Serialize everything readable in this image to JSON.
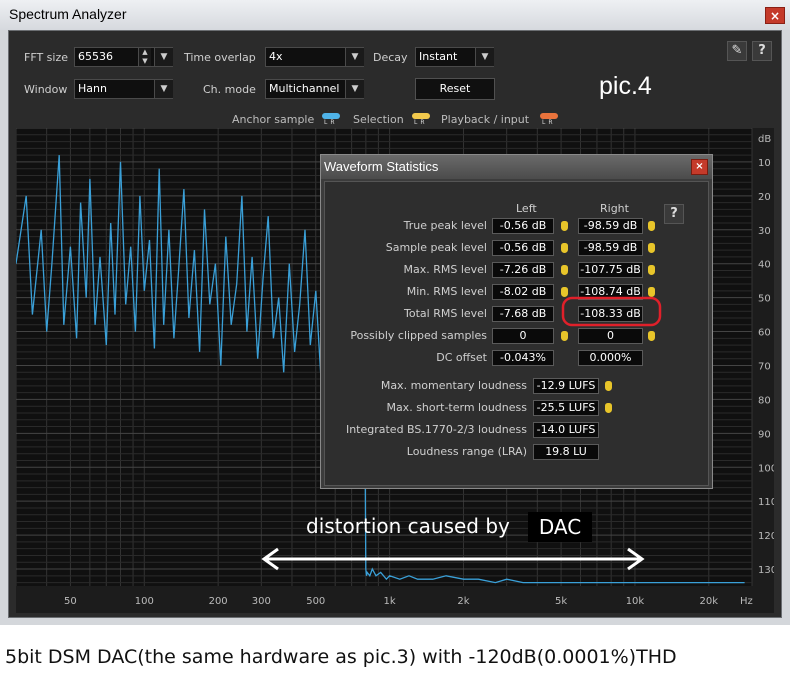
{
  "window": {
    "title": "Spectrum Analyzer",
    "close": "×"
  },
  "controls": {
    "fft_size_label": "FFT size",
    "fft_size_value": "65536",
    "time_overlap_label": "Time overlap",
    "time_overlap_value": "4x",
    "decay_label": "Decay",
    "decay_value": "Instant",
    "window_label": "Window",
    "window_value": "Hann",
    "ch_mode_label": "Ch. mode",
    "ch_mode_value": "Multichannel",
    "reset_label": "Reset",
    "settings_icon": "wrench-icon",
    "help_label": "?"
  },
  "pic_label": "pic.4",
  "legend": {
    "anchor_label": "Anchor sample",
    "selection_label": "Selection",
    "playback_label": "Playback / input",
    "lr": "LR",
    "colors": {
      "anchor": "#4fb3e8",
      "selection": "#f2c94c",
      "playback": "#e9733c"
    }
  },
  "stats_dialog": {
    "title": "Waveform Statistics",
    "close": "×",
    "help": "?",
    "col_left": "Left",
    "col_right": "Right",
    "rows": [
      {
        "label": "True peak level",
        "left": "-0.56 dB",
        "right": "-98.59 dB"
      },
      {
        "label": "Sample peak level",
        "left": "-0.56 dB",
        "right": "-98.59 dB"
      },
      {
        "label": "Max. RMS level",
        "left": "-7.26 dB",
        "right": "-107.75 dB"
      },
      {
        "label": "Min. RMS level",
        "left": "-8.02 dB",
        "right": "-108.74 dB"
      },
      {
        "label": "Total RMS level",
        "left": "-7.68 dB",
        "right": "-108.33 dB"
      },
      {
        "label": "Possibly clipped samples",
        "left": "0",
        "right": "0"
      },
      {
        "label": "DC offset",
        "left": "-0.043%",
        "right": "0.000%"
      }
    ],
    "loudness": [
      {
        "label": "Max. momentary loudness",
        "value": "-12.9 LUFS"
      },
      {
        "label": "Max. short-term loudness",
        "value": "-25.5 LUFS"
      },
      {
        "label": "Integrated BS.1770-2/3 loudness",
        "value": "-14.0 LUFS"
      },
      {
        "label": "Loudness range (LRA)",
        "value": "19.8 LU"
      }
    ]
  },
  "annotation": {
    "text": "distortion caused by",
    "dac": "DAC"
  },
  "caption": "5bit DSM DAC(the same hardware as pic.3) with -120dB(0.0001%)THD",
  "chart_data": {
    "type": "line",
    "xscale": "log",
    "x_ticks": [
      {
        "label": "50",
        "value": 50
      },
      {
        "label": "100",
        "value": 100
      },
      {
        "label": "200",
        "value": 200
      },
      {
        "label": "300",
        "value": 300
      },
      {
        "label": "500",
        "value": 500
      },
      {
        "label": "1k",
        "value": 1000
      },
      {
        "label": "2k",
        "value": 2000
      },
      {
        "label": "5k",
        "value": 5000
      },
      {
        "label": "10k",
        "value": 10000
      },
      {
        "label": "20k",
        "value": 20000
      }
    ],
    "x_unit": "Hz",
    "y_unit": "dB",
    "y_ticks": [
      10,
      20,
      30,
      40,
      50,
      60,
      70,
      80,
      90,
      100,
      110,
      120,
      130
    ],
    "xlim": [
      30,
      30000
    ],
    "ylim": [
      0,
      135
    ],
    "grid": true,
    "series_color": "#3aa0d8",
    "series": [
      {
        "x": [
          30,
          33,
          35,
          38,
          40,
          42,
          45,
          47,
          50,
          53,
          55,
          58,
          60,
          63,
          66,
          70,
          73,
          76,
          80,
          84,
          88,
          92,
          96,
          100,
          105,
          110,
          115,
          120,
          126,
          132,
          138,
          145,
          152,
          160,
          168,
          176,
          185,
          195,
          205,
          215,
          226,
          238,
          250,
          262,
          275,
          290,
          305,
          320,
          336,
          353,
          370,
          390,
          410,
          430,
          452,
          475,
          500,
          525,
          552,
          580,
          610,
          640,
          672,
          700,
          730,
          760,
          790,
          800,
          805,
          810,
          830,
          850,
          880,
          920,
          970,
          1000,
          1100,
          1200,
          1300,
          1500,
          1700,
          2000,
          2300,
          2700,
          3000,
          3500,
          4000,
          5000,
          6000,
          7000,
          8000,
          10000,
          12000,
          15000,
          17000,
          20000,
          22000,
          25000,
          28000
        ],
        "y": [
          40,
          20,
          55,
          30,
          60,
          40,
          8,
          58,
          35,
          62,
          22,
          50,
          15,
          58,
          38,
          64,
          28,
          55,
          10,
          52,
          35,
          60,
          20,
          48,
          33,
          65,
          12,
          58,
          30,
          62,
          42,
          18,
          56,
          36,
          66,
          24,
          52,
          40,
          70,
          32,
          58,
          46,
          20,
          60,
          38,
          68,
          44,
          26,
          62,
          50,
          72,
          40,
          66,
          52,
          30,
          64,
          48,
          74,
          56,
          38,
          70,
          60,
          80,
          52,
          75,
          90,
          68,
          130,
          132,
          131,
          132,
          130,
          132,
          131,
          133,
          132,
          133,
          132,
          133,
          133,
          132,
          133,
          133,
          134,
          133,
          134,
          134,
          134,
          134,
          134,
          134,
          134,
          134,
          134,
          134,
          134,
          134,
          134,
          134
        ]
      }
    ]
  }
}
